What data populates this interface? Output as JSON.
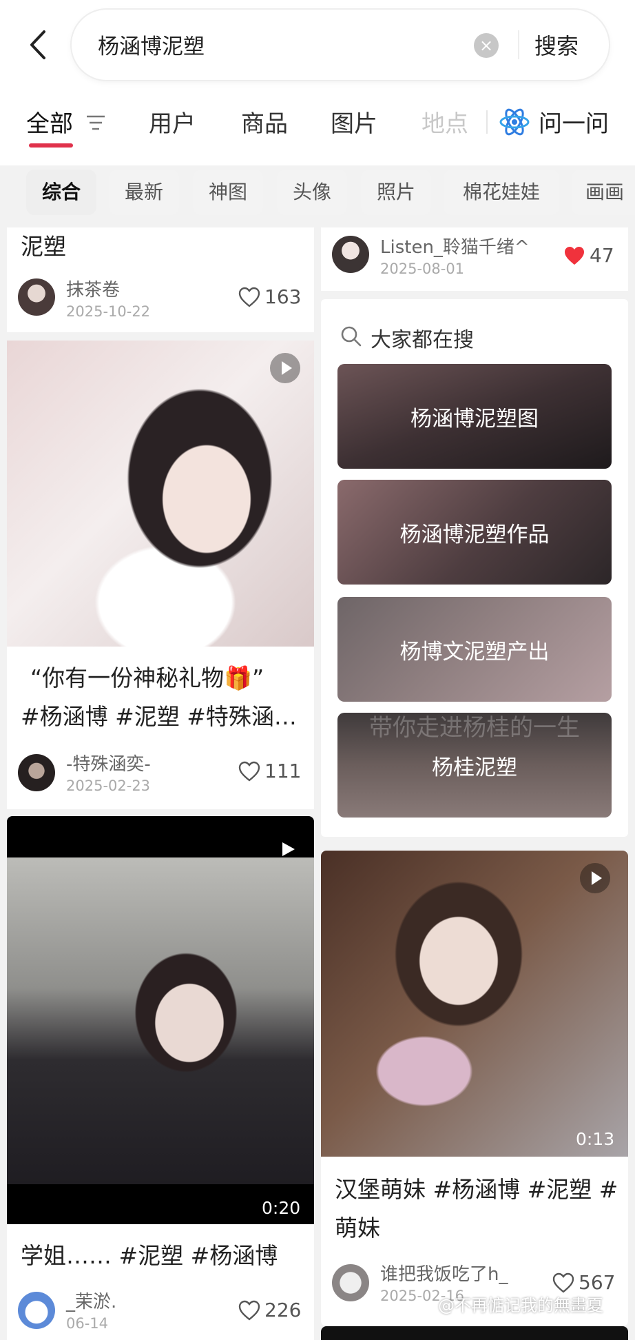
{
  "search": {
    "query": "杨涵博泥塑",
    "button": "搜索"
  },
  "tabs": [
    {
      "label": "全部"
    },
    {
      "label": "用户"
    },
    {
      "label": "商品"
    },
    {
      "label": "图片"
    },
    {
      "label": "地点"
    }
  ],
  "ask": {
    "label": "问一问"
  },
  "chips": [
    "综合",
    "最新",
    "神图",
    "头像",
    "照片",
    "棉花娃娃",
    "画画"
  ],
  "cards": {
    "top_left": {
      "title": "泥塑",
      "author": "抹茶卷",
      "date": "2025-10-22",
      "likes": "163"
    },
    "top_right": {
      "author": "Listen_聆猫千绪^",
      "date": "2025-08-01",
      "likes": "47"
    },
    "mid_left": {
      "title1": "“你有一份神秘礼物🎁”",
      "title2": "#杨涵博 #泥塑 #特殊涵…",
      "author": "-特殊涵奕-",
      "date": "2025-02-23",
      "likes": "111"
    },
    "bottom_left": {
      "duration": "0:20",
      "title": "学姐…… #泥塑 #杨涵博",
      "author": "_茉淤.",
      "date": "06-14",
      "likes": "226"
    },
    "bottom_right": {
      "duration": "0:13",
      "title1": "汉堡萌妹 #杨涵博 #泥塑 #",
      "title2": "萌妹",
      "author": "谁把我饭吃了h_",
      "date": "2025-02-16",
      "likes": "567"
    }
  },
  "suggestions": {
    "title": "大家都在搜",
    "items": [
      "杨涵博泥塑图",
      "杨涵博泥塑作品",
      "杨博文泥塑产出",
      "杨桂泥塑"
    ],
    "overlay_text": "带你走进杨桂的一生"
  },
  "watermark": "@不再惦记我的無畫夏",
  "colors": {
    "accent": "#e0314b",
    "heart_filled": "#f0323c",
    "background": "#f2f2f2"
  }
}
